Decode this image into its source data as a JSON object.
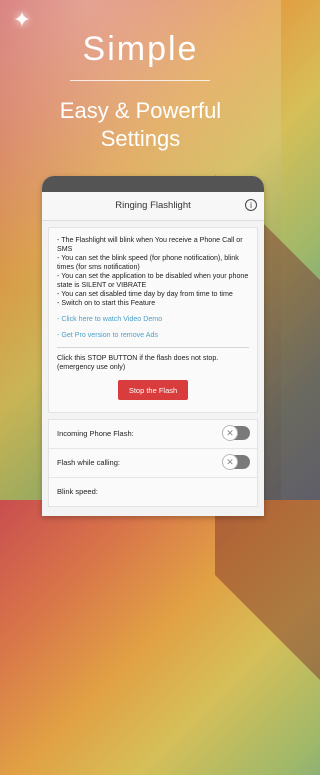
{
  "promo": {
    "title": "Simple",
    "subtitle_line1": "Easy & Powerful",
    "subtitle_line2": "Settings"
  },
  "appbar": {
    "title": "Ringing Flashlight",
    "info_icon": "info-icon",
    "info_glyph": "i"
  },
  "description": "- The Flashlight will blink when You receive a Phone Call or SMS\n- You can set the blink speed (for phone notification), blink times (for sms notification)\n- You can set the application to be disabled when your phone state is SILENT or VIBRATE\n- You can set disabled time day by day from time to time\n- Switch on to start this Feature",
  "links": {
    "video": "- Click here to watch Video Demo",
    "pro": "- Get Pro version to remove Ads"
  },
  "stop": {
    "note": "Click this STOP BUTTON if the flash does not stop.\n(emergency use only)",
    "button_label": "Stop the Flash"
  },
  "settings": [
    {
      "label": "Incoming Phone Flash:",
      "toggle": "off"
    },
    {
      "label": "Flash while calling:",
      "toggle": "off"
    },
    {
      "label": "Blink speed:",
      "toggle": null
    }
  ],
  "colors": {
    "accent_red": "#d83c3c",
    "link_blue": "#4ea1c7"
  }
}
